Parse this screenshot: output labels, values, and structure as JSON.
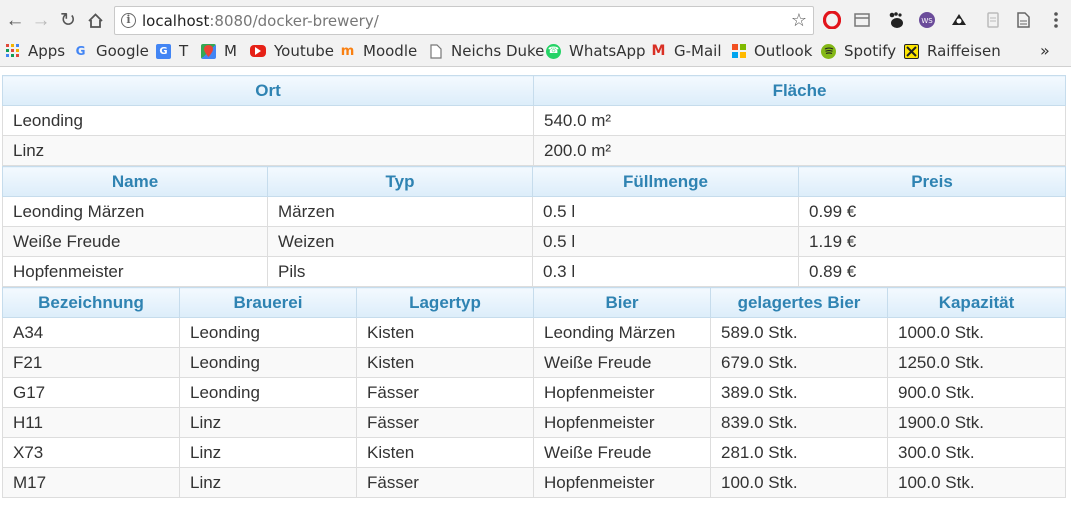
{
  "browser": {
    "url_host": "localhost",
    "url_rest": ":8080/docker-brewery/",
    "bookmarks": [
      {
        "label": "Apps",
        "icon": "apps-grid-icon",
        "color": "#e04a3b"
      },
      {
        "label": "Google",
        "icon": "google-icon",
        "color": "#4285f4"
      },
      {
        "label": "T",
        "icon": "translate-icon",
        "color": "#4285f4"
      },
      {
        "label": "M",
        "icon": "maps-icon",
        "color": "#34a853"
      },
      {
        "label": "Youtube",
        "icon": "youtube-icon",
        "color": "#e62117"
      },
      {
        "label": "Moodle",
        "icon": "moodle-icon",
        "color": "#f98012"
      },
      {
        "label": "Neichs Duke",
        "icon": "page-icon",
        "color": "#888888"
      },
      {
        "label": "WhatsApp",
        "icon": "whatsapp-icon",
        "color": "#25d366"
      },
      {
        "label": "G-Mail",
        "icon": "gmail-icon",
        "color": "#d93025"
      },
      {
        "label": "Outlook",
        "icon": "microsoft-icon",
        "color": "#0078d4"
      },
      {
        "label": "Spotify",
        "icon": "spotify-icon",
        "color": "#84b817"
      },
      {
        "label": "Raiffeisen",
        "icon": "raiffeisen-icon",
        "color": "#fee600"
      }
    ],
    "more": "»"
  },
  "storage_table": {
    "headers": [
      "Ort",
      "Fläche"
    ],
    "rows": [
      [
        "Leonding",
        "540.0 m²"
      ],
      [
        "Linz",
        "200.0 m²"
      ]
    ]
  },
  "beer_table": {
    "headers": [
      "Name",
      "Typ",
      "Füllmenge",
      "Preis"
    ],
    "rows": [
      [
        "Leonding Märzen",
        "Märzen",
        "0.5 l",
        "0.99 €"
      ],
      [
        "Weiße Freude",
        "Weizen",
        "0.5 l",
        "1.19 €"
      ],
      [
        "Hopfenmeister",
        "Pils",
        "0.3 l",
        "0.89 €"
      ]
    ]
  },
  "inventory_table": {
    "headers": [
      "Bezeichnung",
      "Brauerei",
      "Lagertyp",
      "Bier",
      "gelagertes Bier",
      "Kapazität"
    ],
    "rows": [
      [
        "A34",
        "Leonding",
        "Kisten",
        "Leonding Märzen",
        "589.0 Stk.",
        "1000.0 Stk."
      ],
      [
        "F21",
        "Leonding",
        "Kisten",
        "Weiße Freude",
        "679.0 Stk.",
        "1250.0 Stk."
      ],
      [
        "G17",
        "Leonding",
        "Fässer",
        "Hopfenmeister",
        "389.0 Stk.",
        "900.0 Stk."
      ],
      [
        "H11",
        "Linz",
        "Fässer",
        "Hopfenmeister",
        "839.0 Stk.",
        "1900.0 Stk."
      ],
      [
        "X73",
        "Linz",
        "Kisten",
        "Weiße Freude",
        "281.0 Stk.",
        "300.0 Stk."
      ],
      [
        "M17",
        "Linz",
        "Fässer",
        "Hopfenmeister",
        "100.0 Stk.",
        "100.0 Stk."
      ]
    ]
  }
}
